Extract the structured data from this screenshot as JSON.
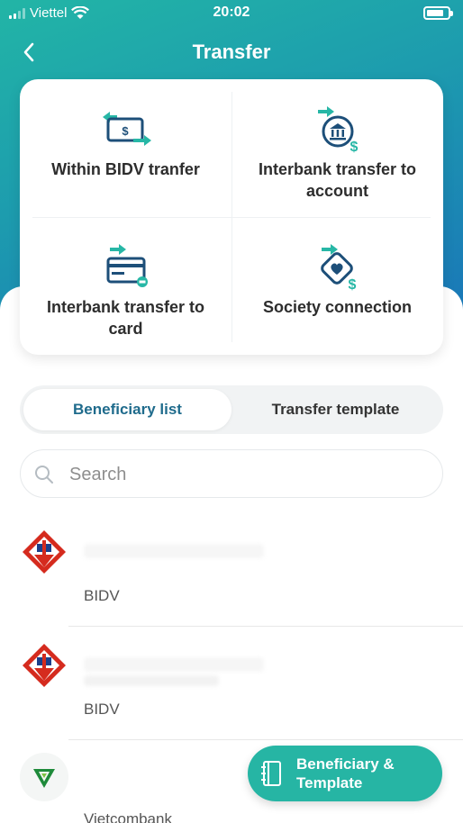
{
  "status_bar": {
    "carrier": "Viettel",
    "time": "20:02"
  },
  "header": {
    "title": "Transfer",
    "back_icon": "chevron-left-icon"
  },
  "services": [
    {
      "label": "Within BIDV tranfer",
      "icon": "money-transfer-icon"
    },
    {
      "label": "Interbank transfer to account",
      "icon": "bank-transfer-icon"
    },
    {
      "label": "Interbank transfer to card",
      "icon": "card-transfer-icon"
    },
    {
      "label": "Society connection",
      "icon": "heart-connection-icon"
    }
  ],
  "tabs": {
    "active": "Beneficiary list",
    "inactive": "Transfer template"
  },
  "search": {
    "placeholder": "Search"
  },
  "beneficiaries": [
    {
      "bank": "BIDV",
      "logo": "bidv-logo"
    },
    {
      "bank": "BIDV",
      "logo": "bidv-logo"
    },
    {
      "bank": "Vietcombank",
      "logo": "vietcombank-logo"
    }
  ],
  "fab": {
    "label": "Beneficiary & Template",
    "icon": "notebook-icon"
  },
  "colors": {
    "teal": "#26b5a4",
    "blue": "#1a78b8",
    "active_tab": "#1f6b8c",
    "bidv_red": "#d52b1e"
  }
}
